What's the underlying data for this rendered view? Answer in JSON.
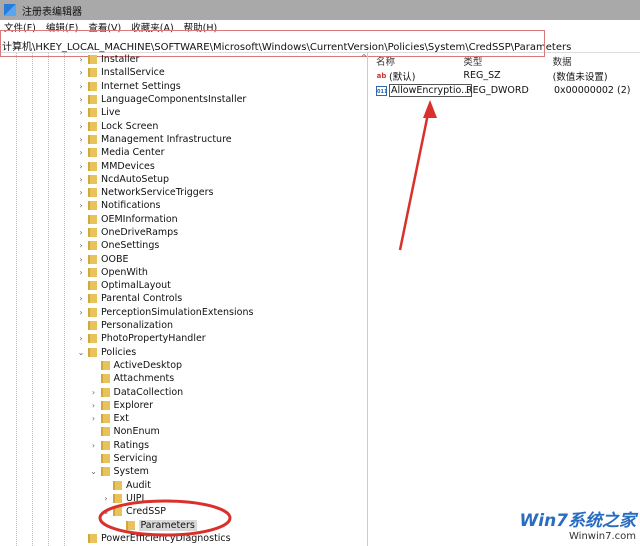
{
  "window": {
    "title": "注册表编辑器"
  },
  "menu": [
    "文件(F)",
    "编辑(E)",
    "查看(V)",
    "收藏夹(A)",
    "帮助(H)"
  ],
  "address": "计算机\\HKEY_LOCAL_MACHINE\\SOFTWARE\\Microsoft\\Windows\\CurrentVersion\\Policies\\System\\CredSSP\\Parameters",
  "tree": [
    {
      "label": "Installer",
      "level": 0,
      "exp": ">"
    },
    {
      "label": "InstallService",
      "level": 0,
      "exp": ">"
    },
    {
      "label": "Internet Settings",
      "level": 0,
      "exp": ">"
    },
    {
      "label": "LanguageComponentsInstaller",
      "level": 0,
      "exp": ">"
    },
    {
      "label": "Live",
      "level": 0,
      "exp": ">"
    },
    {
      "label": "Lock Screen",
      "level": 0,
      "exp": ">"
    },
    {
      "label": "Management Infrastructure",
      "level": 0,
      "exp": ">"
    },
    {
      "label": "Media Center",
      "level": 0,
      "exp": ">"
    },
    {
      "label": "MMDevices",
      "level": 0,
      "exp": ">"
    },
    {
      "label": "NcdAutoSetup",
      "level": 0,
      "exp": ">"
    },
    {
      "label": "NetworkServiceTriggers",
      "level": 0,
      "exp": ">"
    },
    {
      "label": "Notifications",
      "level": 0,
      "exp": ">"
    },
    {
      "label": "OEMInformation",
      "level": 0,
      "exp": ""
    },
    {
      "label": "OneDriveRamps",
      "level": 0,
      "exp": ">"
    },
    {
      "label": "OneSettings",
      "level": 0,
      "exp": ">"
    },
    {
      "label": "OOBE",
      "level": 0,
      "exp": ">"
    },
    {
      "label": "OpenWith",
      "level": 0,
      "exp": ">"
    },
    {
      "label": "OptimalLayout",
      "level": 0,
      "exp": ""
    },
    {
      "label": "Parental Controls",
      "level": 0,
      "exp": ">"
    },
    {
      "label": "PerceptionSimulationExtensions",
      "level": 0,
      "exp": ">"
    },
    {
      "label": "Personalization",
      "level": 0,
      "exp": ""
    },
    {
      "label": "PhotoPropertyHandler",
      "level": 0,
      "exp": ">"
    },
    {
      "label": "Policies",
      "level": 0,
      "exp": "v"
    },
    {
      "label": "ActiveDesktop",
      "level": 1,
      "exp": ""
    },
    {
      "label": "Attachments",
      "level": 1,
      "exp": ""
    },
    {
      "label": "DataCollection",
      "level": 1,
      "exp": ">"
    },
    {
      "label": "Explorer",
      "level": 1,
      "exp": ">"
    },
    {
      "label": "Ext",
      "level": 1,
      "exp": ">"
    },
    {
      "label": "NonEnum",
      "level": 1,
      "exp": ""
    },
    {
      "label": "Ratings",
      "level": 1,
      "exp": ">"
    },
    {
      "label": "Servicing",
      "level": 1,
      "exp": ""
    },
    {
      "label": "System",
      "level": 1,
      "exp": "v"
    },
    {
      "label": "Audit",
      "level": 2,
      "exp": ""
    },
    {
      "label": "UIPI",
      "level": 2,
      "exp": ">"
    },
    {
      "label": "CredSSP",
      "level": 2,
      "exp": "v"
    },
    {
      "label": "Parameters",
      "level": 3,
      "exp": "",
      "selected": true
    },
    {
      "label": "PowerEfficiencyDiagnostics",
      "level": 0,
      "exp": ""
    }
  ],
  "values": {
    "headers": {
      "name": "名称",
      "type": "类型",
      "data": "数据"
    },
    "rows": [
      {
        "icon": "ab",
        "name": "(默认)",
        "type": "REG_SZ",
        "data": "(数值未设置)"
      },
      {
        "icon": "bin",
        "name": "AllowEncryptio...",
        "type": "REG_DWORD",
        "data": "0x00000002 (2)",
        "editing": true
      }
    ]
  },
  "watermark": {
    "brand": "Win7系统之家",
    "url": "Winwin7.com"
  },
  "colors": {
    "annotation": "#d9302c"
  }
}
